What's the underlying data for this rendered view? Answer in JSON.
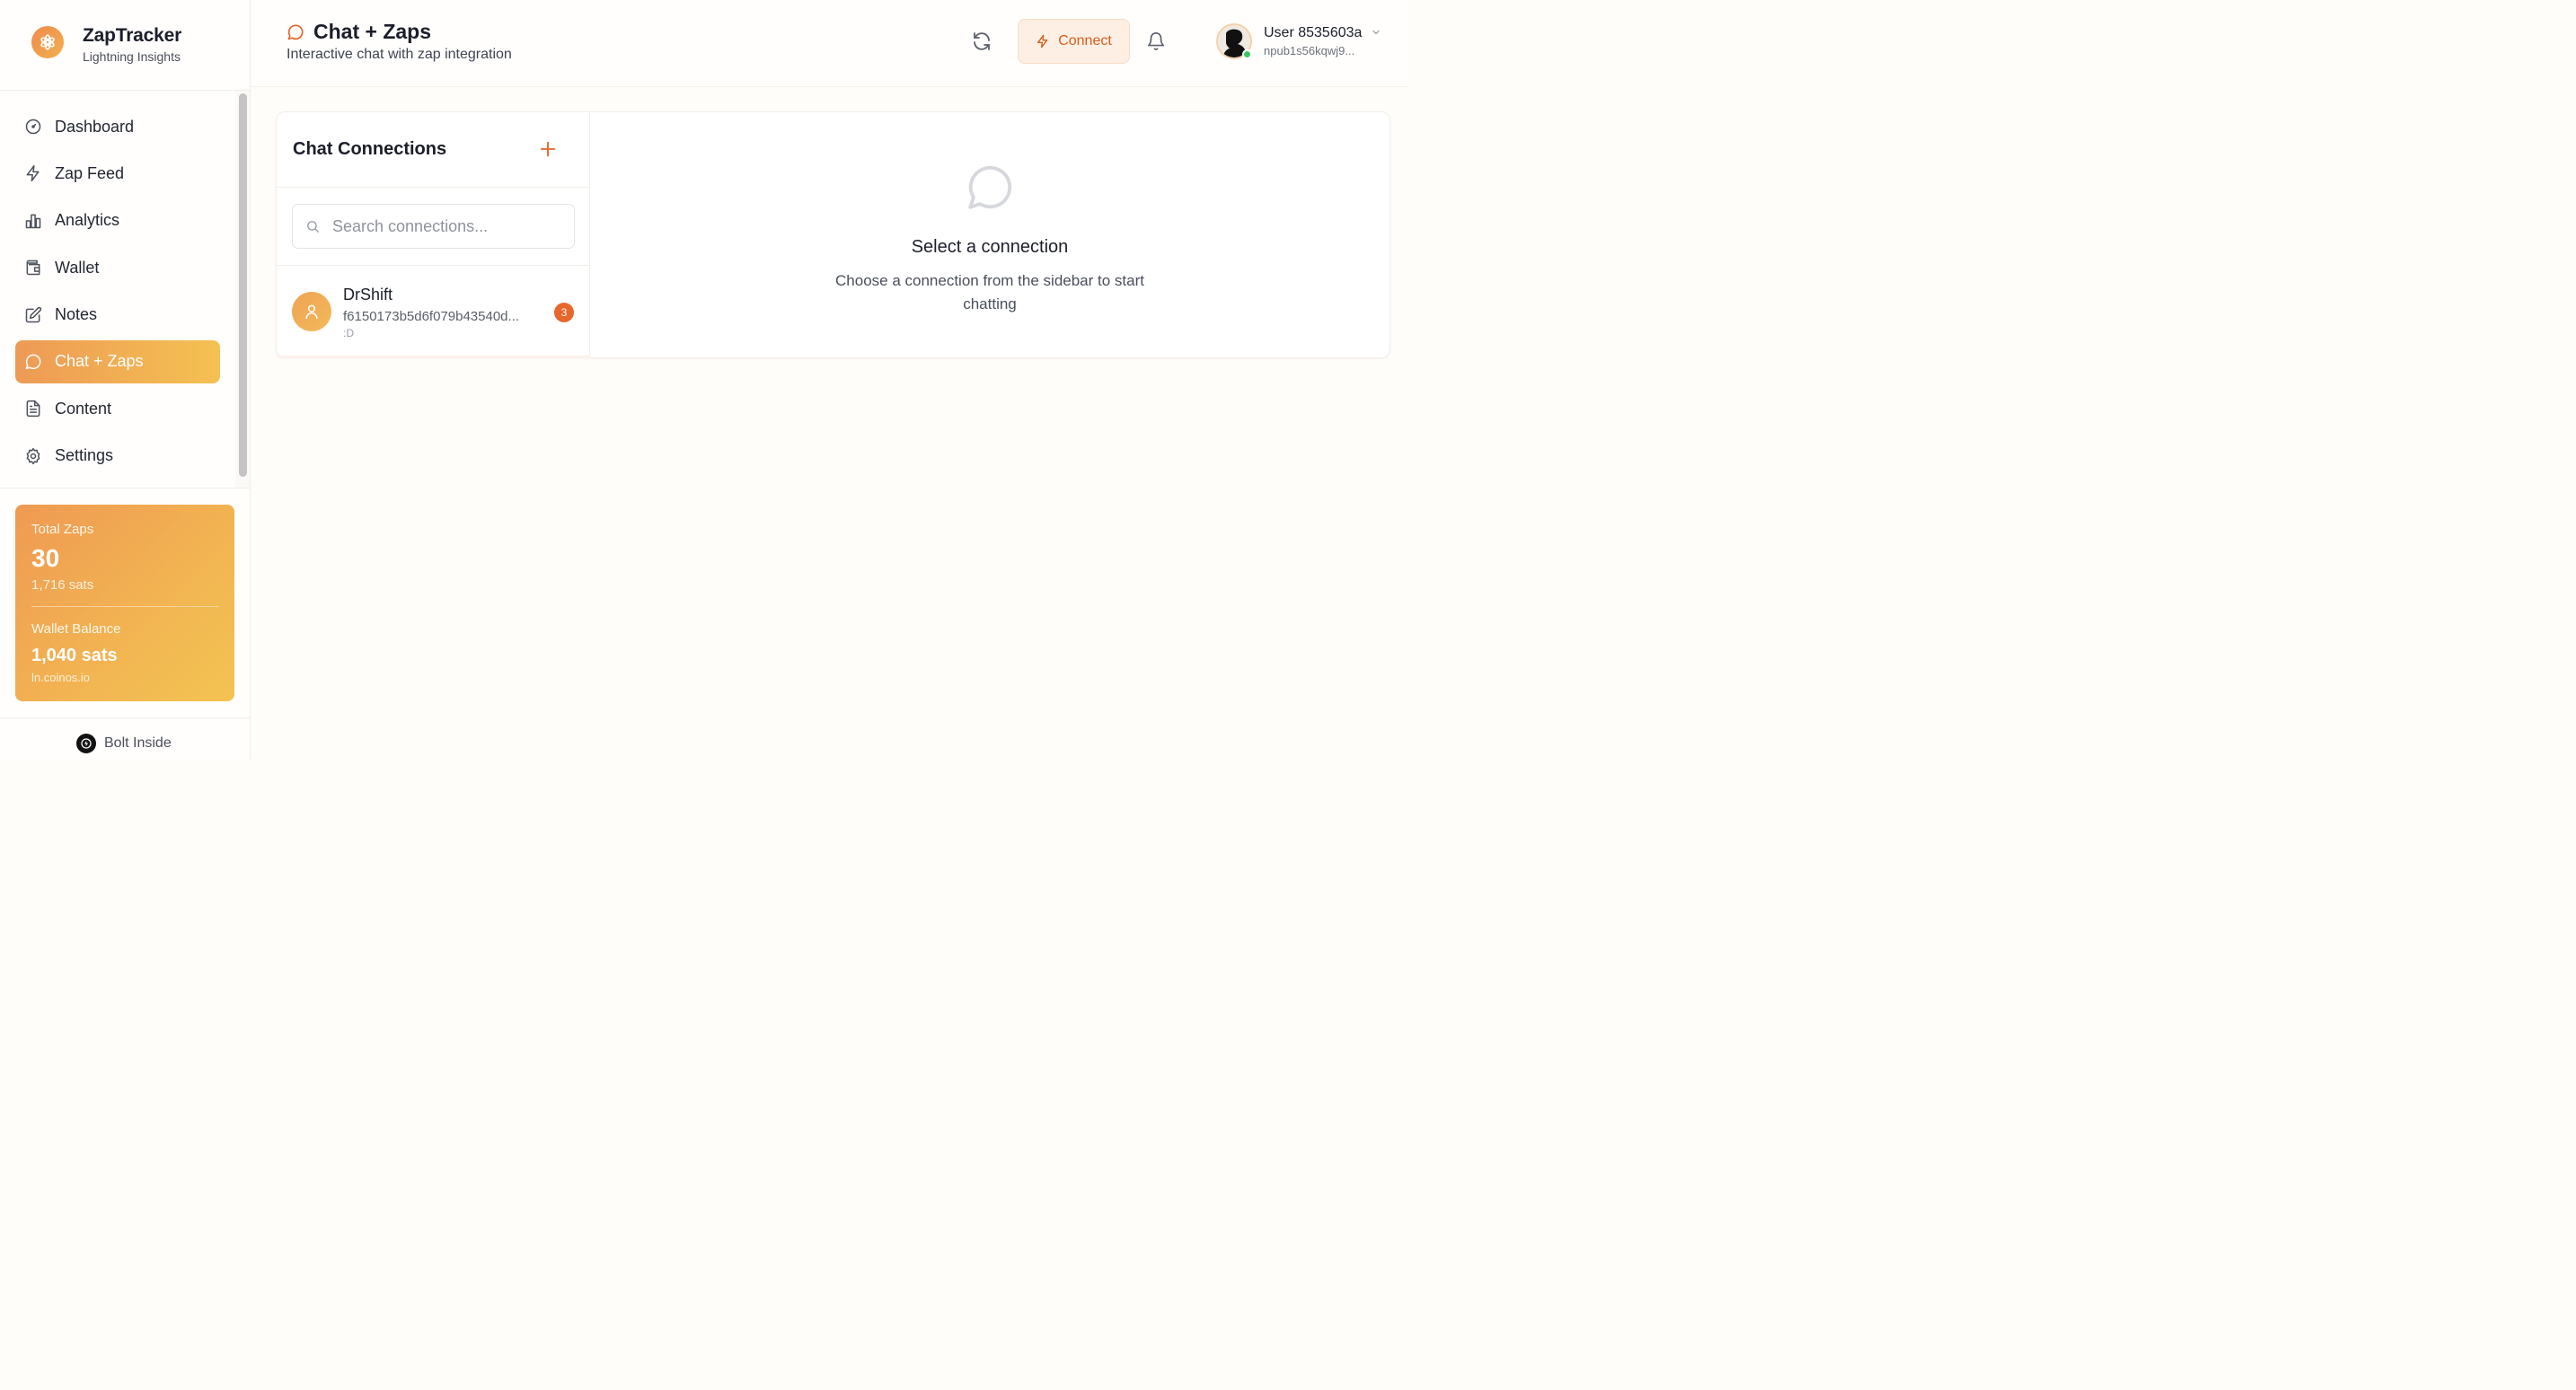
{
  "brand": {
    "name": "ZapTracker",
    "subtitle": "Lightning Insights",
    "logo_icon": "flower-icon"
  },
  "sidebar": {
    "items": [
      {
        "label": "Dashboard",
        "icon": "gauge-icon",
        "active": false
      },
      {
        "label": "Zap Feed",
        "icon": "lightning-icon",
        "active": false
      },
      {
        "label": "Analytics",
        "icon": "bar-chart-icon",
        "active": false
      },
      {
        "label": "Wallet",
        "icon": "wallet-icon",
        "active": false
      },
      {
        "label": "Notes",
        "icon": "pencil-square-icon",
        "active": false
      },
      {
        "label": "Chat + Zaps",
        "icon": "chat-bubble-icon",
        "active": true
      },
      {
        "label": "Content",
        "icon": "document-icon",
        "active": false
      },
      {
        "label": "Settings",
        "icon": "gear-icon",
        "active": false
      }
    ]
  },
  "stats": {
    "total_zaps_label": "Total Zaps",
    "total_zaps_value": "30",
    "total_zaps_sats": "1,716 sats",
    "wallet_label": "Wallet Balance",
    "wallet_value": "1,040 sats",
    "wallet_provider": "ln.coinos.io"
  },
  "footer": {
    "label": "Bolt Inside"
  },
  "header": {
    "title": "Chat + Zaps",
    "subtitle": "Interactive chat with zap integration",
    "connect_label": "Connect",
    "user_name": "User 8535603a",
    "user_npub": "npub1s56kqwj9..."
  },
  "connections": {
    "title": "Chat Connections",
    "search_placeholder": "Search connections...",
    "search_value": "",
    "items": [
      {
        "name": "DrShift",
        "pubkey": "f6150173b5d6f079b43540d...",
        "last_message": ":D",
        "unread": "3"
      }
    ]
  },
  "empty_state": {
    "title": "Select a connection",
    "text": "Choose a connection from the sidebar to start chatting"
  },
  "colors": {
    "accent": "#e8672b",
    "gradient_start": "#ee9a55",
    "gradient_end": "#f4c152",
    "online": "#3fc464"
  }
}
